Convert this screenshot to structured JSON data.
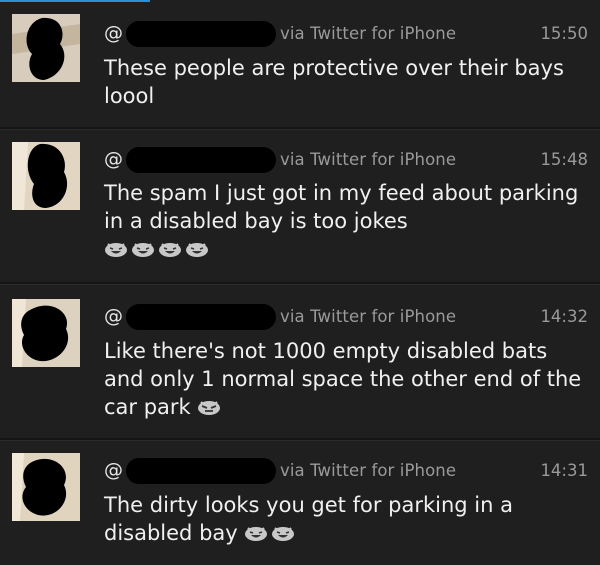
{
  "tweets": [
    {
      "handle_prefix": "@",
      "source": "via Twitter for iPhone",
      "time": "15:50",
      "text": "These people are protective over their bays loool",
      "emojis": []
    },
    {
      "handle_prefix": "@",
      "source": "via Twitter for iPhone",
      "time": "15:48",
      "text": "The spam I just got in my feed about parking in a disabled bay is too jokes",
      "emojis": [
        "laughing-face-icon",
        "laughing-face-icon",
        "laughing-face-icon",
        "laughing-face-icon"
      ]
    },
    {
      "handle_prefix": "@",
      "source": "via Twitter for iPhone",
      "time": "14:32",
      "text": "Like there's not 1000 empty disabled bats and only 1 normal space the other end of the car park",
      "emojis": [
        "unamused-face-icon"
      ]
    },
    {
      "handle_prefix": "@",
      "source": "via Twitter for iPhone",
      "time": "14:31",
      "text": "The dirty looks you get for parking in a disabled bay",
      "emojis": [
        "laughing-face-icon",
        "laughing-face-icon"
      ]
    }
  ],
  "colors": {
    "background": "#1f1f1f",
    "accent": "#2a8fd4",
    "meta_text": "#9a9a9a",
    "body_text": "#f0f0f0"
  }
}
